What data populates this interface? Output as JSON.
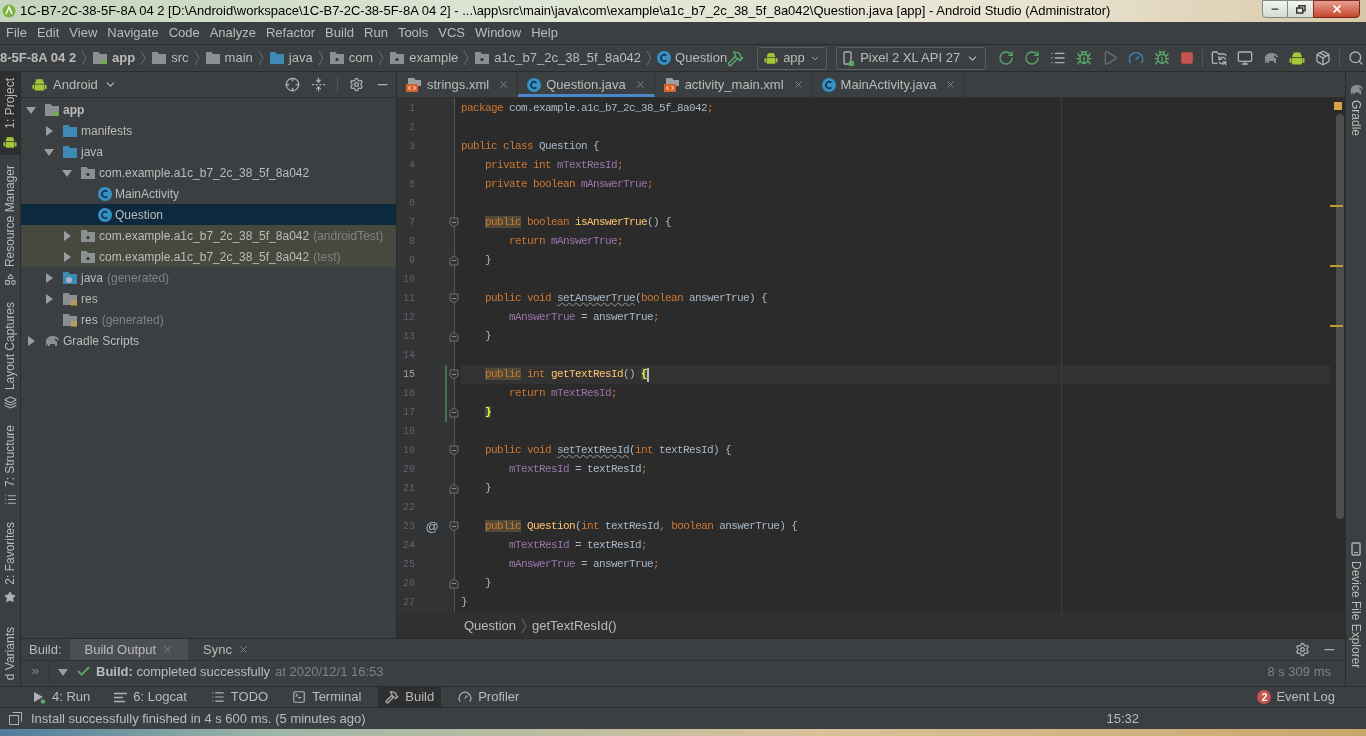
{
  "window": {
    "title": "1C-B7-2C-38-5F-8A 04 2 [D:\\Android\\workspace\\1C-B7-2C-38-5F-8A 04 2] - ...\\app\\src\\main\\java\\com\\example\\a1c_b7_2c_38_5f_8a042\\Question.java [app] - Android Studio (Administrator)"
  },
  "menu": [
    "File",
    "Edit",
    "View",
    "Navigate",
    "Code",
    "Analyze",
    "Refactor",
    "Build",
    "Run",
    "Tools",
    "VCS",
    "Window",
    "Help"
  ],
  "navigation_bar": [
    {
      "label": "8-5F-8A 04 2",
      "kind": "project"
    },
    {
      "label": "app",
      "kind": "module"
    },
    {
      "label": "src",
      "kind": "folder"
    },
    {
      "label": "main",
      "kind": "folder"
    },
    {
      "label": "java",
      "kind": "source_folder"
    },
    {
      "label": "com",
      "kind": "package_folder"
    },
    {
      "label": "example",
      "kind": "package_folder"
    },
    {
      "label": "a1c_b7_2c_38_5f_8a042",
      "kind": "package_folder"
    },
    {
      "label": "Question",
      "kind": "class"
    }
  ],
  "toolbar": {
    "module": "app",
    "device": "Pixel 2 XL API 27"
  },
  "left_tool_windows": [
    {
      "label": "1: Project",
      "kind": "project",
      "selected": true
    },
    {
      "label": "Resource Manager",
      "kind": "resources",
      "selected": false
    },
    {
      "label": "Layout Captures",
      "kind": "captures",
      "selected": false
    },
    {
      "label": "7: Structure",
      "kind": "structure",
      "selected": false
    },
    {
      "label": "2: Favorites",
      "kind": "favorites",
      "selected": false
    },
    {
      "label": "d Variants",
      "kind": "variants",
      "selected": false
    }
  ],
  "project_panel": {
    "view": "Android",
    "tree": [
      {
        "label": "app",
        "kind": "module",
        "expanded": true,
        "selected": false,
        "children": [
          {
            "label": "manifests",
            "kind": "folder",
            "expanded": false,
            "selected": false
          },
          {
            "label": "java",
            "kind": "folder",
            "expanded": true,
            "selected": false,
            "children": [
              {
                "label": "com.example.a1c_b7_2c_38_5f_8a042",
                "kind": "package",
                "expanded": true,
                "selected": false,
                "children": [
                  {
                    "label": "MainActivity",
                    "kind": "class",
                    "selected": false
                  },
                  {
                    "label": "Question",
                    "kind": "class",
                    "selected": true
                  }
                ]
              },
              {
                "label": "com.example.a1c_b7_2c_38_5f_8a042",
                "suffix": "(androidTest)",
                "kind": "test_package",
                "expanded": false,
                "selected": false
              },
              {
                "label": "com.example.a1c_b7_2c_38_5f_8a042",
                "suffix": "(test)",
                "kind": "test_package",
                "expanded": false,
                "selected": false
              }
            ]
          },
          {
            "label": "java",
            "suffix": "(generated)",
            "kind": "generated_folder",
            "expanded": false,
            "selected": false
          },
          {
            "label": "res",
            "kind": "res_folder",
            "expanded": false,
            "selected": false
          },
          {
            "label": "res",
            "suffix": "(generated)",
            "kind": "res_folder",
            "selected": false
          }
        ]
      },
      {
        "label": "Gradle Scripts",
        "kind": "gradle",
        "expanded": false,
        "selected": false
      }
    ]
  },
  "editor": {
    "tabs": [
      {
        "label": "strings.xml",
        "kind": "xml",
        "selected": false
      },
      {
        "label": "Question.java",
        "kind": "java",
        "selected": true
      },
      {
        "label": "activity_main.xml",
        "kind": "xml",
        "selected": false
      },
      {
        "label": "MainActivity.java",
        "kind": "java",
        "selected": false
      }
    ],
    "lines": [
      {
        "number": "1",
        "kind": "statement",
        "current": false,
        "changed": false,
        "tokens": [
          {
            "text": "package",
            "kind": "keyword"
          },
          {
            "text": " com.example.a1c_b7_2c_38_5f_8a042",
            "kind": "plain"
          },
          {
            "text": ";",
            "kind": "keyword"
          }
        ]
      },
      {
        "number": "2",
        "kind": "blank",
        "current": false,
        "changed": false
      },
      {
        "number": "3",
        "kind": "statement",
        "current": false,
        "changed": false,
        "tokens": [
          {
            "text": "public class",
            "kind": "keyword"
          },
          {
            "text": " Question {",
            "kind": "plain"
          }
        ]
      },
      {
        "number": "4",
        "kind": "statement",
        "current": false,
        "changed": false,
        "tokens": [
          {
            "text": "    private int ",
            "kind": "keyword"
          },
          {
            "text": "mTextResId",
            "kind": "field"
          },
          {
            "text": ";",
            "kind": "keyword"
          }
        ]
      },
      {
        "number": "5",
        "kind": "statement",
        "current": false,
        "changed": false,
        "tokens": [
          {
            "text": "    private boolean ",
            "kind": "keyword"
          },
          {
            "text": "mAnswerTrue",
            "kind": "field"
          },
          {
            "text": ";",
            "kind": "keyword"
          }
        ]
      },
      {
        "number": "6",
        "kind": "blank",
        "current": false,
        "changed": false
      },
      {
        "number": "7",
        "kind": "block_start",
        "current": false,
        "changed": false,
        "tokens": [
          {
            "text": "    public",
            "kind": "marked_keyword"
          },
          {
            "text": " boolean ",
            "kind": "keyword"
          },
          {
            "text": "isAnswerTrue",
            "kind": "declaration"
          },
          {
            "text": "() {",
            "kind": "plain"
          }
        ]
      },
      {
        "number": "8",
        "kind": "statement",
        "current": false,
        "changed": false,
        "tokens": [
          {
            "text": "        return ",
            "kind": "keyword"
          },
          {
            "text": "mAnswerTrue",
            "kind": "field"
          },
          {
            "text": ";",
            "kind": "keyword"
          }
        ]
      },
      {
        "number": "9",
        "kind": "block_end",
        "current": false,
        "changed": false,
        "tokens": [
          {
            "text": "    }",
            "kind": "plain"
          }
        ]
      },
      {
        "number": "10",
        "kind": "blank",
        "current": false,
        "changed": false
      },
      {
        "number": "11",
        "kind": "block_start",
        "current": false,
        "changed": false,
        "tokens": [
          {
            "text": "    public void ",
            "kind": "keyword"
          },
          {
            "text": "setAnswerTrue",
            "kind": "unused_method"
          },
          {
            "text": "(",
            "kind": "plain"
          },
          {
            "text": "boolean",
            "kind": "keyword"
          },
          {
            "text": " answerTrue) {",
            "kind": "plain"
          }
        ]
      },
      {
        "number": "12",
        "kind": "statement",
        "current": false,
        "changed": false,
        "tokens": [
          {
            "text": "        mAnswerTrue",
            "kind": "field"
          },
          {
            "text": " = answerTrue",
            "kind": "plain"
          },
          {
            "text": ";",
            "kind": "keyword"
          }
        ]
      },
      {
        "number": "13",
        "kind": "block_end",
        "current": false,
        "changed": false,
        "tokens": [
          {
            "text": "    }",
            "kind": "plain"
          }
        ]
      },
      {
        "number": "14",
        "kind": "blank",
        "current": false,
        "changed": false
      },
      {
        "number": "15",
        "kind": "block_start",
        "current": true,
        "changed": true,
        "tokens": [
          {
            "text": "    public",
            "kind": "marked_keyword"
          },
          {
            "text": " int ",
            "kind": "keyword"
          },
          {
            "text": "getTextResId",
            "kind": "declaration"
          },
          {
            "text": "() ",
            "kind": "plain"
          },
          {
            "text": "{",
            "kind": "matched_brace"
          }
        ]
      },
      {
        "number": "16",
        "kind": "statement",
        "current": false,
        "changed": true,
        "tokens": [
          {
            "text": "        return ",
            "kind": "keyword"
          },
          {
            "text": "mTextResId",
            "kind": "field"
          },
          {
            "text": ";",
            "kind": "keyword"
          }
        ]
      },
      {
        "number": "17",
        "kind": "block_end",
        "current": false,
        "changed": true,
        "tokens": [
          {
            "text": "    }",
            "kind": "matched_brace"
          }
        ]
      },
      {
        "number": "18",
        "kind": "blank",
        "current": false,
        "changed": false
      },
      {
        "number": "19",
        "kind": "block_start",
        "current": false,
        "changed": false,
        "tokens": [
          {
            "text": "    public void ",
            "kind": "keyword"
          },
          {
            "text": "setTextResId",
            "kind": "unused_method"
          },
          {
            "text": "(",
            "kind": "plain"
          },
          {
            "text": "int",
            "kind": "keyword"
          },
          {
            "text": " textResId) {",
            "kind": "plain"
          }
        ]
      },
      {
        "number": "20",
        "kind": "statement",
        "current": false,
        "changed": false,
        "tokens": [
          {
            "text": "        mTextResId",
            "kind": "field"
          },
          {
            "text": " = textResId",
            "kind": "plain"
          },
          {
            "text": ";",
            "kind": "keyword"
          }
        ]
      },
      {
        "number": "21",
        "kind": "block_end",
        "current": false,
        "changed": false,
        "tokens": [
          {
            "text": "    }",
            "kind": "plain"
          }
        ]
      },
      {
        "number": "22",
        "kind": "blank",
        "current": false,
        "changed": false
      },
      {
        "number": "23",
        "kind": "block_start",
        "current": false,
        "changed": false,
        "gutter_mark": "@",
        "tokens": [
          {
            "text": "    public",
            "kind": "marked_keyword"
          },
          {
            "text": " Question",
            "kind": "declaration"
          },
          {
            "text": "(",
            "kind": "plain"
          },
          {
            "text": "int",
            "kind": "keyword"
          },
          {
            "text": " textResId",
            "kind": "plain"
          },
          {
            "text": ",",
            "kind": "keyword"
          },
          {
            "text": " boolean",
            "kind": "keyword"
          },
          {
            "text": " answerTrue) {",
            "kind": "plain"
          }
        ]
      },
      {
        "number": "24",
        "kind": "statement",
        "current": false,
        "changed": false,
        "tokens": [
          {
            "text": "        mTextResId",
            "kind": "field"
          },
          {
            "text": " = textResId",
            "kind": "plain"
          },
          {
            "text": ";",
            "kind": "keyword"
          }
        ]
      },
      {
        "number": "25",
        "kind": "statement",
        "current": false,
        "changed": false,
        "tokens": [
          {
            "text": "        mAnswerTrue",
            "kind": "field"
          },
          {
            "text": " = answerTrue",
            "kind": "plain"
          },
          {
            "text": ";",
            "kind": "keyword"
          }
        ]
      },
      {
        "number": "26",
        "kind": "block_end",
        "current": false,
        "changed": false,
        "tokens": [
          {
            "text": "    }",
            "kind": "plain"
          }
        ]
      },
      {
        "number": "27",
        "kind": "statement",
        "current": false,
        "changed": false,
        "tokens": [
          {
            "text": "}",
            "kind": "plain"
          }
        ]
      }
    ],
    "breadcrumbs": [
      "Question",
      "getTextResId()"
    ]
  },
  "right_tool_windows": [
    {
      "label": "Gradle",
      "kind": "gradle"
    },
    {
      "label": "Device File Explorer",
      "kind": "device"
    }
  ],
  "build_panel": {
    "title": "Build:",
    "tabs": [
      {
        "label": "Build Output",
        "selected": true
      },
      {
        "label": "Sync",
        "selected": false
      }
    ],
    "rows": [
      {
        "expanded": true,
        "succeeded": true,
        "message": "**Build:** completed successfully",
        "time": "at 2020/12/1 16:53",
        "duration": "8 s 309 ms"
      }
    ]
  },
  "tool_window_bar": [
    {
      "label": "4: Run",
      "kind": "run",
      "selected": false
    },
    {
      "label": "6: Logcat",
      "kind": "logcat",
      "selected": false
    },
    {
      "label": "TODO",
      "kind": "todo",
      "selected": false
    },
    {
      "label": "Terminal",
      "kind": "terminal",
      "selected": false
    },
    {
      "label": "Build",
      "kind": "build",
      "selected": true
    },
    {
      "label": "Profiler",
      "kind": "profiler",
      "selected": false
    }
  ],
  "event_log": {
    "count": "2",
    "label": "Event Log"
  },
  "status_bar": {
    "message": "Install successfully finished in 4 s 600 ms. (5 minutes ago)",
    "position": "15:32"
  }
}
